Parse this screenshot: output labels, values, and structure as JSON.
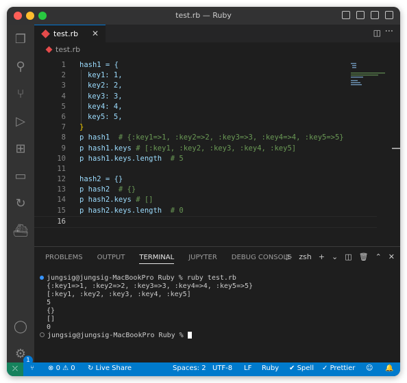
{
  "window": {
    "title": "test.rb — Ruby"
  },
  "editor": {
    "tab_label": "test.rb",
    "breadcrumb": "test.rb",
    "lines": [
      {
        "n": "1"
      },
      {
        "n": "2"
      },
      {
        "n": "3"
      },
      {
        "n": "4"
      },
      {
        "n": "5"
      },
      {
        "n": "6"
      },
      {
        "n": "7"
      },
      {
        "n": "8"
      },
      {
        "n": "9"
      },
      {
        "n": "10"
      },
      {
        "n": "11"
      },
      {
        "n": "12"
      },
      {
        "n": "13"
      },
      {
        "n": "14"
      },
      {
        "n": "15"
      },
      {
        "n": "16"
      }
    ],
    "code": {
      "l1": "hash1 = {",
      "l2": "key1: 1,",
      "l3": "key2: 2,",
      "l4": "key3: 3,",
      "l5": "key4: 4,",
      "l6": "key5: 5,",
      "l7": "}",
      "l8a": "p hash1  ",
      "l8b": "# {:key1=>1, :key2=>2, :key3=>3, :key4=>4, :key5=>5}",
      "l9a": "p hash1.keys ",
      "l9b": "# [:key1, :key2, :key3, :key4, :key5]",
      "l10a": "p hash1.keys.length  ",
      "l10b": "# 5",
      "l12": "hash2 = {}",
      "l13a": "p hash2  ",
      "l13b": "# {}",
      "l14a": "p hash2.keys ",
      "l14b": "# []",
      "l15a": "p hash2.keys.length  ",
      "l15b": "# 0"
    }
  },
  "panel": {
    "tabs": [
      "PROBLEMS",
      "OUTPUT",
      "TERMINAL",
      "JUPYTER",
      "DEBUG CONSOLE"
    ],
    "shell": "zsh",
    "terminal_lines": [
      "jungsig@jungsig-MacBookPro Ruby % ruby test.rb",
      "{:key1=>1, :key2=>2, :key3=>3, :key4=>4, :key5=>5}",
      "[:key1, :key2, :key3, :key4, :key5]",
      "5",
      "{}",
      "[]",
      "0",
      "jungsig@jungsig-MacBookPro Ruby % "
    ]
  },
  "activity": {
    "badge": "1"
  },
  "status": {
    "errors": "0",
    "warnings": "0",
    "live_share": "Live Share",
    "spaces": "Spaces: 2",
    "encoding": "UTF-8",
    "eol": "LF",
    "language": "Ruby",
    "spell": "Spell",
    "prettier": "Prettier"
  },
  "colors": {
    "accent": "#007acc",
    "success_dot": "#2d8cf0",
    "ruby": "#e54b4b"
  }
}
